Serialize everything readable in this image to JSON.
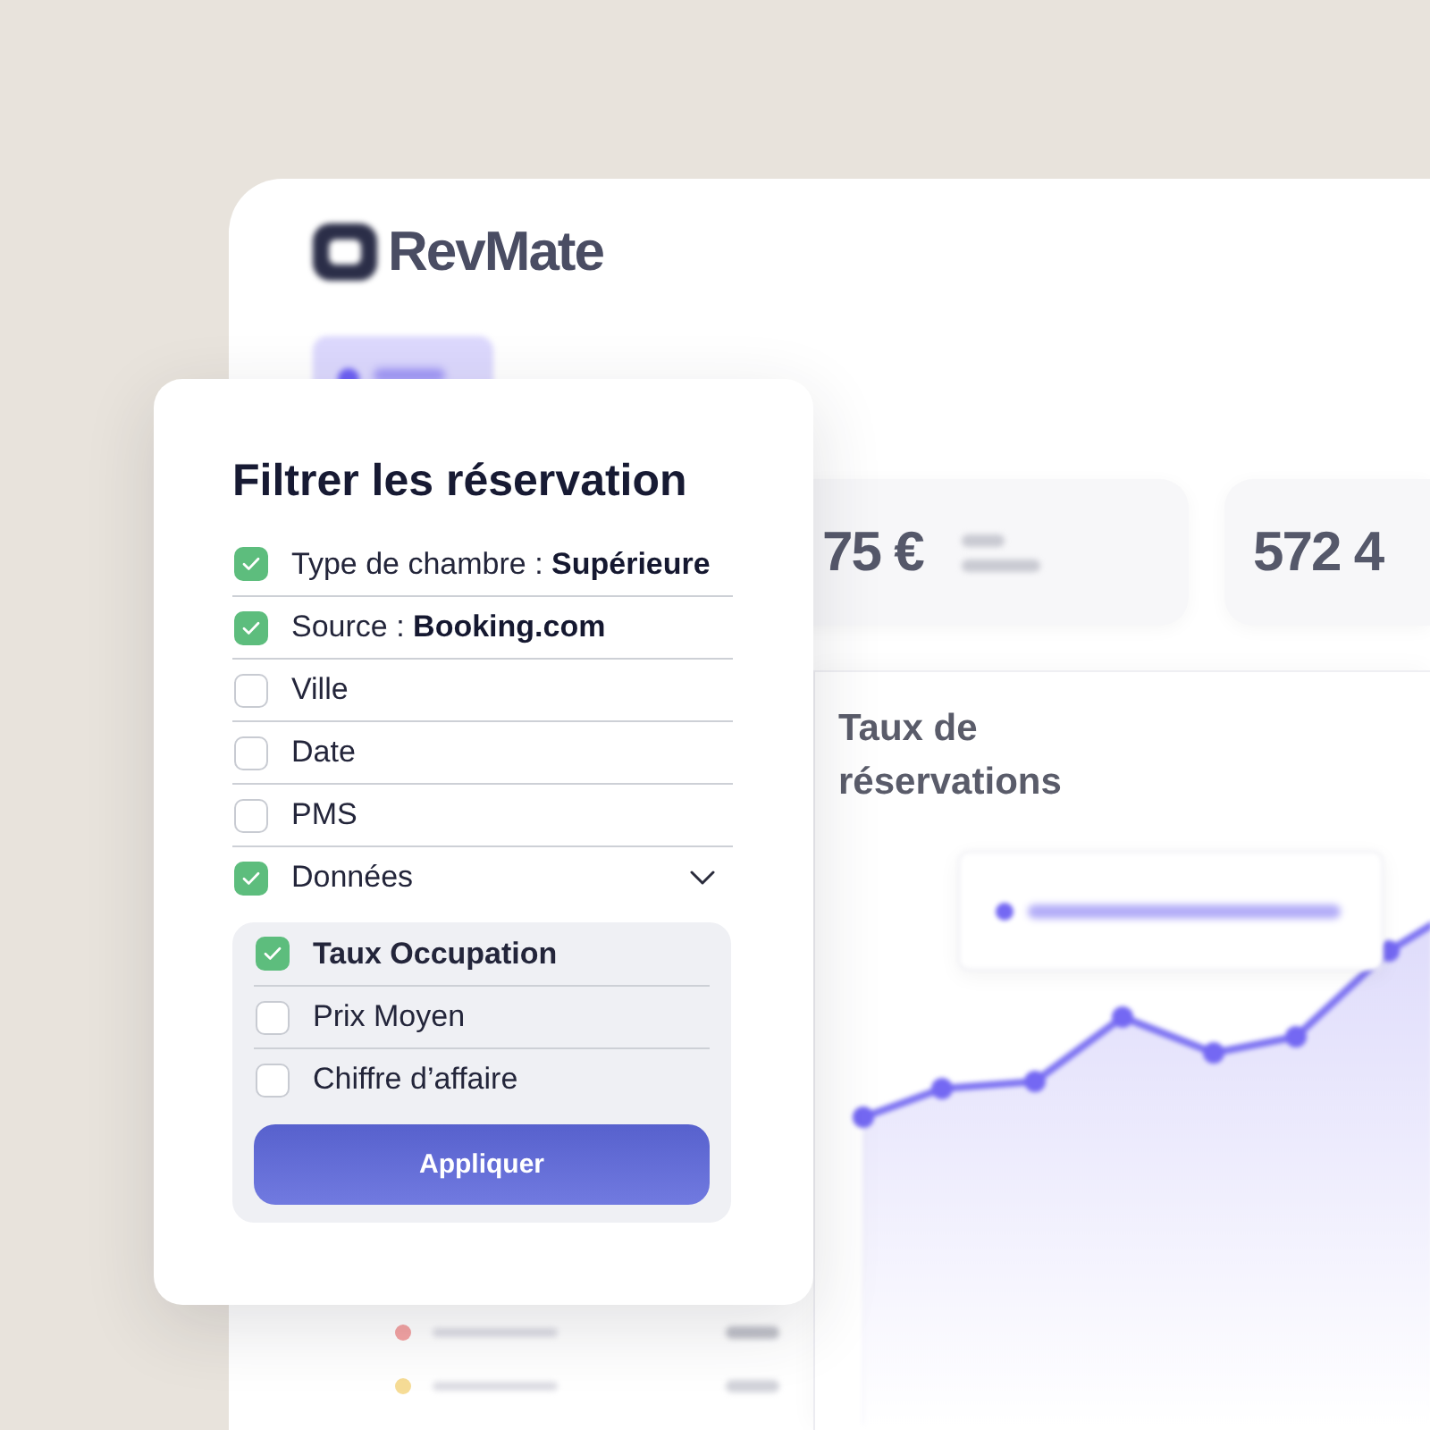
{
  "dashboard": {
    "logo": {
      "name": "RevMate"
    },
    "kpis": [
      {
        "value": "75 €"
      },
      {
        "value": "572 4"
      }
    ],
    "chart": {
      "title": "Taux de réservations"
    },
    "table": {
      "rows": [
        {
          "color": "#f4a3a3"
        },
        {
          "color": "#f6dc96"
        }
      ]
    }
  },
  "filter_panel": {
    "title": "Filtrer les réservation",
    "filters": [
      {
        "kind": "option",
        "label": "Type de chambre : **Supérieure**",
        "checked": true
      },
      {
        "kind": "option",
        "label": "Source : **Booking.com**",
        "checked": true
      },
      {
        "kind": "option",
        "label": "Ville",
        "checked": false
      },
      {
        "kind": "option",
        "label": "Date",
        "checked": false
      },
      {
        "kind": "option",
        "label": "PMS",
        "checked": false
      },
      {
        "kind": "group",
        "label": "Données",
        "checked": true,
        "expanded": true,
        "children": [
          {
            "label": "Taux Occupation",
            "checked": true
          },
          {
            "label": "Prix Moyen",
            "checked": false
          },
          {
            "label": "Chiffre d’affaire",
            "checked": false
          }
        ],
        "button": "Appliquer"
      }
    ]
  }
}
